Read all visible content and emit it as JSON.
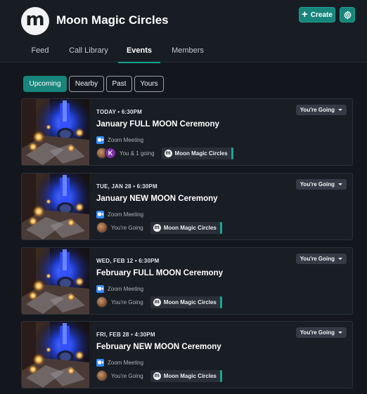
{
  "header": {
    "logo_letter": "m",
    "title": "Moon Magic Circles",
    "create_label": "Create",
    "create_icon": "plus-icon",
    "settings_icon": "gear-icon"
  },
  "nav": {
    "tabs": [
      {
        "label": "Feed",
        "active": false
      },
      {
        "label": "Call Library",
        "active": false
      },
      {
        "label": "Events",
        "active": true
      },
      {
        "label": "Members",
        "active": false
      }
    ]
  },
  "filters": [
    {
      "label": "Upcoming",
      "active": true
    },
    {
      "label": "Nearby",
      "active": false
    },
    {
      "label": "Past",
      "active": false
    },
    {
      "label": "Yours",
      "active": false
    }
  ],
  "events": [
    {
      "date": "TODAY • 6:30PM",
      "title": "January FULL MOON Ceremony",
      "meeting": "Zoom Meeting",
      "attendance": "You & 1 going",
      "extra_avatar_letter": "K",
      "group": "Moon Magic Circles",
      "rsvp": "You're Going"
    },
    {
      "date": "TUE, JAN 28 • 6:30PM",
      "title": "January NEW MOON Ceremony",
      "meeting": "Zoom Meeting",
      "attendance": "You're Going",
      "group": "Moon Magic Circles",
      "rsvp": "You're Going"
    },
    {
      "date": "WED, FEB 12 • 6:30PM",
      "title": "February FULL MOON Ceremony",
      "meeting": "Zoom Meeting",
      "attendance": "You're Going",
      "group": "Moon Magic Circles",
      "rsvp": "You're Going"
    },
    {
      "date": "FRI, FEB 28 • 4:30PM",
      "title": "February NEW MOON Ceremony",
      "meeting": "Zoom Meeting",
      "attendance": "You're Going",
      "group": "Moon Magic Circles",
      "rsvp": "You're Going"
    }
  ],
  "colors": {
    "accent": "#17857b",
    "background": "#13171d",
    "card": "#191d24",
    "zoom": "#2d8cff"
  }
}
